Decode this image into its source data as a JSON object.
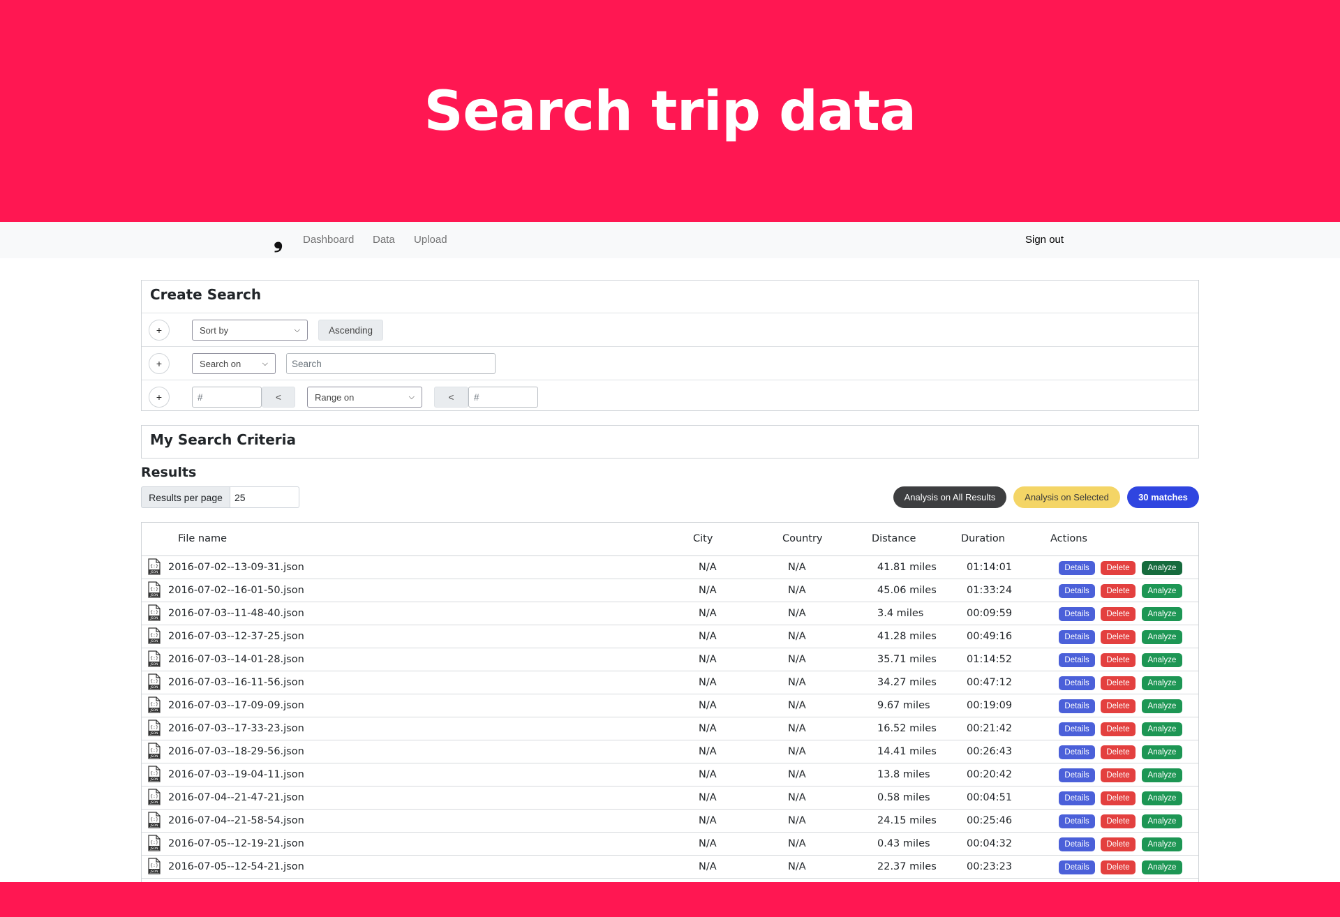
{
  "hero": {
    "title": "Search trip data"
  },
  "navbar": {
    "brand": "❟",
    "links": [
      "Dashboard",
      "Data",
      "Upload"
    ],
    "sign_out": "Sign out"
  },
  "create_search": {
    "title": "Create Search",
    "plus_label": "+",
    "sort_by": "Sort by",
    "order_label": "Ascending",
    "search_on": "Search on",
    "search_placeholder": "Search",
    "range_min_placeholder": "#",
    "less_than": "<",
    "range_on": "Range on",
    "range_max_placeholder": "#"
  },
  "criteria": {
    "title": "My Search Criteria"
  },
  "results": {
    "title": "Results",
    "per_page_label": "Results per page",
    "per_page_value": "25",
    "analysis_all": "Analysis on All Results",
    "analysis_selected": "Analysis on Selected",
    "match_count": "30 matches"
  },
  "table": {
    "columns": [
      "File name",
      "City",
      "Country",
      "Distance",
      "Duration",
      "Actions"
    ],
    "action_labels": {
      "details": "Details",
      "delete": "Delete",
      "analyze": "Analyze"
    },
    "rows": [
      {
        "file": "2016-07-02--13-09-31.json",
        "city": "N/A",
        "country": "N/A",
        "distance": "41.81 miles",
        "duration": "01:14:01"
      },
      {
        "file": "2016-07-02--16-01-50.json",
        "city": "N/A",
        "country": "N/A",
        "distance": "45.06 miles",
        "duration": "01:33:24"
      },
      {
        "file": "2016-07-03--11-48-40.json",
        "city": "N/A",
        "country": "N/A",
        "distance": "3.4 miles",
        "duration": "00:09:59"
      },
      {
        "file": "2016-07-03--12-37-25.json",
        "city": "N/A",
        "country": "N/A",
        "distance": "41.28 miles",
        "duration": "00:49:16"
      },
      {
        "file": "2016-07-03--14-01-28.json",
        "city": "N/A",
        "country": "N/A",
        "distance": "35.71 miles",
        "duration": "01:14:52"
      },
      {
        "file": "2016-07-03--16-11-56.json",
        "city": "N/A",
        "country": "N/A",
        "distance": "34.27 miles",
        "duration": "00:47:12"
      },
      {
        "file": "2016-07-03--17-09-09.json",
        "city": "N/A",
        "country": "N/A",
        "distance": "9.67 miles",
        "duration": "00:19:09"
      },
      {
        "file": "2016-07-03--17-33-23.json",
        "city": "N/A",
        "country": "N/A",
        "distance": "16.52 miles",
        "duration": "00:21:42"
      },
      {
        "file": "2016-07-03--18-29-56.json",
        "city": "N/A",
        "country": "N/A",
        "distance": "14.41 miles",
        "duration": "00:26:43"
      },
      {
        "file": "2016-07-03--19-04-11.json",
        "city": "N/A",
        "country": "N/A",
        "distance": "13.8 miles",
        "duration": "00:20:42"
      },
      {
        "file": "2016-07-04--21-47-21.json",
        "city": "N/A",
        "country": "N/A",
        "distance": "0.58 miles",
        "duration": "00:04:51"
      },
      {
        "file": "2016-07-04--21-58-54.json",
        "city": "N/A",
        "country": "N/A",
        "distance": "24.15 miles",
        "duration": "00:25:46"
      },
      {
        "file": "2016-07-05--12-19-21.json",
        "city": "N/A",
        "country": "N/A",
        "distance": "0.43 miles",
        "duration": "00:04:32"
      },
      {
        "file": "2016-07-05--12-54-21.json",
        "city": "N/A",
        "country": "N/A",
        "distance": "22.37 miles",
        "duration": "00:23:23"
      }
    ]
  },
  "colors": {
    "brand": "#ff1752",
    "details": "#4b60d9",
    "delete": "#e3403f",
    "analyze": "#1d9654",
    "match_pill": "#2f45e0",
    "selected_pill": "#f4d566"
  },
  "icons": {
    "file": "json-file-icon",
    "dropdown": "chevron-down-icon"
  }
}
